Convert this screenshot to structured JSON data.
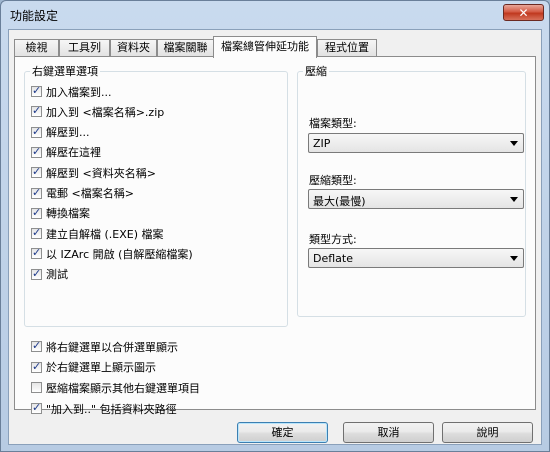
{
  "window": {
    "title": "功能設定",
    "close_label": "✕"
  },
  "tabs": [
    {
      "label": "檢視"
    },
    {
      "label": "工具列"
    },
    {
      "label": "資料夾"
    },
    {
      "label": "檔案關聯"
    },
    {
      "label": "檔案總管伸延功能"
    },
    {
      "label": "程式位置"
    }
  ],
  "active_tab": 4,
  "context_menu": {
    "legend": "右鍵選單選項",
    "items": [
      {
        "label": "加入檔案到...",
        "checked": true
      },
      {
        "label": "加入到 <檔案名稱>.zip",
        "checked": true
      },
      {
        "label": "解壓到...",
        "checked": true
      },
      {
        "label": "解壓在這裡",
        "checked": true
      },
      {
        "label": "解壓到 <資料夾名稱>",
        "checked": true
      },
      {
        "label": "電郵 <檔案名稱>",
        "checked": true
      },
      {
        "label": "轉換檔案",
        "checked": true
      },
      {
        "label": "建立自解檔 (.EXE) 檔案",
        "checked": true
      },
      {
        "label": "以 IZArc 開啟 (自解壓縮檔案)",
        "checked": true
      },
      {
        "label": "測試",
        "checked": true
      }
    ]
  },
  "compression": {
    "legend": "壓縮",
    "file_type_label": "檔案類型:",
    "file_type_value": "ZIP",
    "level_label": "壓縮類型:",
    "level_value": "最大(最慢)",
    "method_label": "類型方式:",
    "method_value": "Deflate"
  },
  "options": [
    {
      "label": "將右鍵選單以合併選單顯示",
      "checked": true
    },
    {
      "label": "於右鍵選單上顯示圖示",
      "checked": true
    },
    {
      "label": "壓縮檔案顯示其他右鍵選單項目",
      "checked": false
    },
    {
      "label": "\"加入到..\" 包括資料夾路徑",
      "checked": true
    }
  ],
  "buttons": {
    "ok": "確定",
    "cancel": "取消",
    "help": "說明"
  },
  "check_glyph": "✓"
}
